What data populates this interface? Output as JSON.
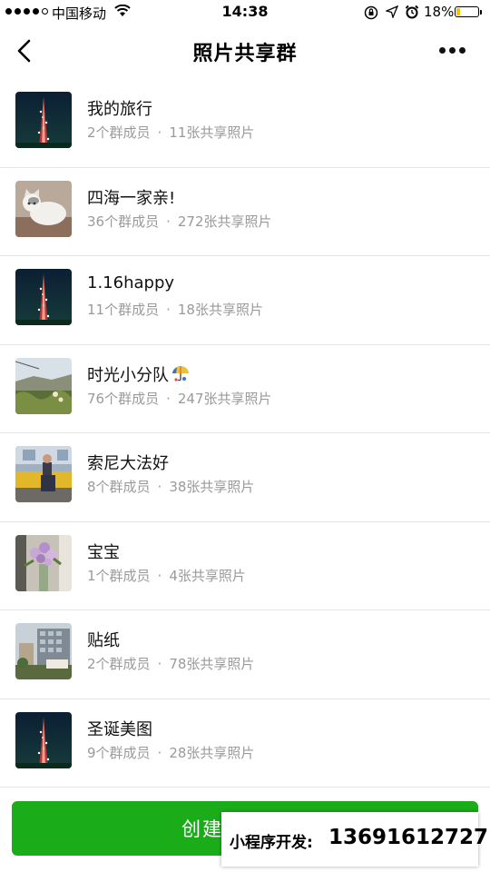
{
  "status_bar": {
    "carrier": "中国移动",
    "time": "14:38",
    "battery": "18%",
    "battery_level": 0.18,
    "battery_color": "#f2c100"
  },
  "nav": {
    "title": "照片共享群",
    "back_icon": "chevron-left-icon",
    "more_icon": "more-dots-icon"
  },
  "groups": [
    {
      "name": "我的旅行",
      "members": "2个群成员",
      "photos": "11张共享照片",
      "sep": "·",
      "thumb": "tower-night"
    },
    {
      "name": "四海一家亲!",
      "members": "36个群成员",
      "photos": "272张共享照片",
      "sep": "·",
      "thumb": "cat"
    },
    {
      "name": "1.16happy",
      "members": "11个群成员",
      "photos": "18张共享照片",
      "sep": "·",
      "thumb": "tower-night"
    },
    {
      "name": "时光小分队",
      "members": "76个群成员",
      "photos": "247张共享照片",
      "sep": "·",
      "thumb": "landscape",
      "emoji": "umbrella-icon"
    },
    {
      "name": "索尼大法好",
      "members": "8个群成员",
      "photos": "38张共享照片",
      "sep": "·",
      "thumb": "train"
    },
    {
      "name": "宝宝",
      "members": "1个群成员",
      "photos": "4张共享照片",
      "sep": "·",
      "thumb": "flowers"
    },
    {
      "name": "贴纸",
      "members": "2个群成员",
      "photos": "78张共享照片",
      "sep": "·",
      "thumb": "building"
    },
    {
      "name": "圣诞美图",
      "members": "9个群成员",
      "photos": "28张共享照片",
      "sep": "·",
      "thumb": "tower-night"
    }
  ],
  "create_button": {
    "label": "创建",
    "color": "#1aad19"
  },
  "watermark": {
    "label": "小程序开发:",
    "phone": "13691612727"
  }
}
